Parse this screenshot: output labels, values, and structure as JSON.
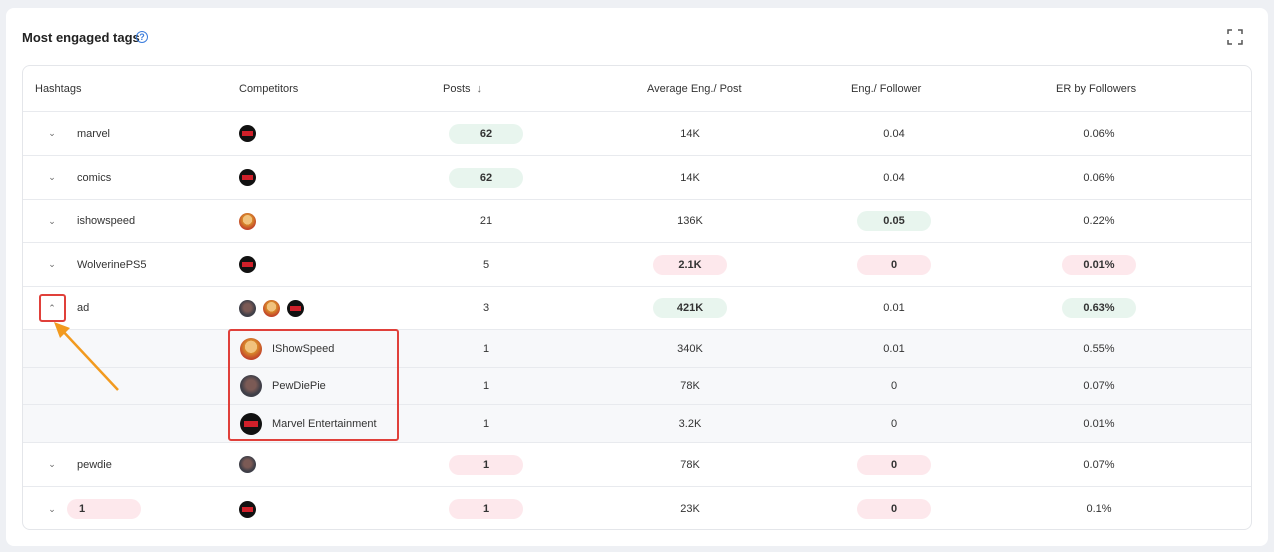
{
  "card": {
    "title": "Most engaged tags",
    "help_icon": "question-circle-icon",
    "expand_icon": "fullscreen-icon"
  },
  "columns": {
    "hashtags": "Hashtags",
    "competitors": "Competitors",
    "posts": "Posts",
    "posts_sort": "↓",
    "avg_eng": "Average Eng./ Post",
    "eng_follower": "Eng./ Follower",
    "er_followers": "ER by Followers"
  },
  "rows": [
    {
      "tag": "marvel",
      "posts": "62",
      "avg": "14K",
      "eng": "0.04",
      "er": "0.06%"
    },
    {
      "tag": "comics",
      "posts": "62",
      "avg": "14K",
      "eng": "0.04",
      "er": "0.06%"
    },
    {
      "tag": "ishowspeed",
      "posts": "21",
      "avg": "136K",
      "eng": "0.05",
      "er": "0.22%"
    },
    {
      "tag": "WolverinePS5",
      "posts": "5",
      "avg": "2.1K",
      "eng": "0",
      "er": "0.01%"
    },
    {
      "tag": "ad",
      "posts": "3",
      "avg": "421K",
      "eng": "0.01",
      "er": "0.63%"
    },
    {
      "tag": "pewdie",
      "posts": "1",
      "avg": "78K",
      "eng": "0",
      "er": "0.07%"
    },
    {
      "tag": "1",
      "posts": "1",
      "avg": "23K",
      "eng": "0",
      "er": "0.1%"
    }
  ],
  "sub_rows": [
    {
      "name": "IShowSpeed",
      "posts": "1",
      "avg": "340K",
      "eng": "0.01",
      "er": "0.55%"
    },
    {
      "name": "PewDiePie",
      "posts": "1",
      "avg": "78K",
      "eng": "0",
      "er": "0.07%"
    },
    {
      "name": "Marvel Entertainment",
      "posts": "1",
      "avg": "3.2K",
      "eng": "0",
      "er": "0.01%"
    }
  ],
  "colors": {
    "pill_green": "#e8f5ee",
    "pill_red": "#fde8ec",
    "annotation_box": "#e0403a",
    "annotation_arrow": "#f29a1f"
  }
}
